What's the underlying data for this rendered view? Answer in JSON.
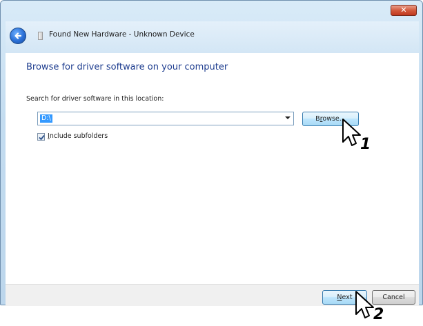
{
  "window": {
    "title": "Found New Hardware - Unknown Device",
    "close_label": "✕"
  },
  "main": {
    "heading": "Browse for driver software on your computer",
    "search_label": "Search for driver software in this location:",
    "location_value": "D:\\",
    "browse_label": "Browse...",
    "include_subfolders_label": "Include subfolders",
    "include_subfolders_checked": true
  },
  "footer": {
    "next_label": "Next",
    "cancel_label": "Cancel"
  },
  "callouts": {
    "step1": "1",
    "step2": "2"
  },
  "colors": {
    "heading": "#1e3d8f",
    "selection": "#3399ff",
    "frame": "#c3dcf0"
  }
}
